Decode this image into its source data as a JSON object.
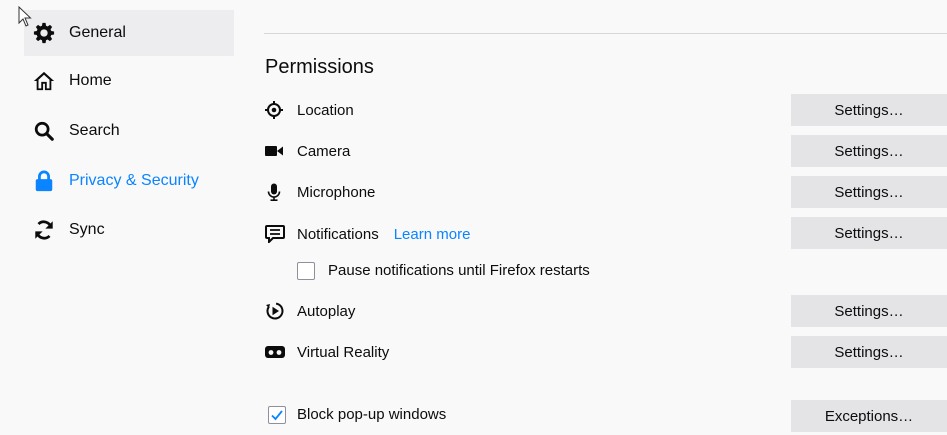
{
  "sidebar": {
    "items": [
      {
        "label": "General",
        "icon": "gear-icon"
      },
      {
        "label": "Home",
        "icon": "home-icon"
      },
      {
        "label": "Search",
        "icon": "search-icon"
      },
      {
        "label": "Privacy & Security",
        "icon": "lock-icon"
      },
      {
        "label": "Sync",
        "icon": "sync-icon"
      }
    ]
  },
  "permissions": {
    "title": "Permissions",
    "location": {
      "label": "Location",
      "button": "Settings…"
    },
    "camera": {
      "label": "Camera",
      "button": "Settings…"
    },
    "microphone": {
      "label": "Microphone",
      "button": "Settings…"
    },
    "notifications": {
      "label": "Notifications",
      "learn_more": "Learn more",
      "button": "Settings…"
    },
    "pause_notifications": {
      "label": "Pause notifications until Firefox restarts",
      "checked": false
    },
    "autoplay": {
      "label": "Autoplay",
      "button": "Settings…"
    },
    "virtual_reality": {
      "label": "Virtual Reality",
      "button": "Settings…"
    },
    "block_popups": {
      "label": "Block pop-up windows",
      "checked": true,
      "button": "Exceptions…"
    }
  },
  "colors": {
    "accent": "#0a84ff",
    "button_bg": "#e4e4e7",
    "selected_bg": "#ededf0",
    "page_bg": "#f9f9fa"
  }
}
